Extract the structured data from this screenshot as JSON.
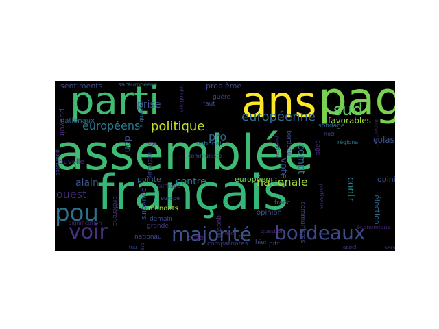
{
  "wordcloud": {
    "background": "#000000",
    "words": [
      {
        "text": "assemblée",
        "color": "#3fbc73"
      },
      {
        "text": "français",
        "color": "#35b779"
      },
      {
        "text": "parti",
        "color": "#3fbc73"
      },
      {
        "text": "ans",
        "color": "#fde725"
      },
      {
        "text": "pag",
        "color": "#7ad151"
      },
      {
        "text": "pou",
        "color": "#2c728e"
      },
      {
        "text": "voir",
        "color": "#46327e"
      },
      {
        "text": "majorité",
        "color": "#3b528b"
      },
      {
        "text": "bordeaux",
        "color": "#3e4989"
      },
      {
        "text": "politique",
        "color": "#c8e020"
      },
      {
        "text": "européenne",
        "color": "#31688e"
      },
      {
        "text": "européens",
        "color": "#2a788e"
      },
      {
        "text": "nationale",
        "color": "#a0da39"
      },
      {
        "text": "sud",
        "color": "#5ec962"
      },
      {
        "text": "alain",
        "color": "#3b528b"
      },
      {
        "text": "ouest",
        "color": "#472d7b"
      },
      {
        "text": "contre",
        "color": "#2a788e"
      },
      {
        "text": "prise",
        "color": "#3b528b"
      },
      {
        "text": "pro",
        "color": "#31688e"
      },
      {
        "text": "vote",
        "color": "#3b528b"
      },
      {
        "text": "compt",
        "color": "#2c728e"
      },
      {
        "text": "contr",
        "color": "#26828e"
      },
      {
        "text": "colas",
        "color": "#3b528b"
      },
      {
        "text": "favorables",
        "color": "#a0da39"
      },
      {
        "text": "européen",
        "color": "#7ad151"
      },
      {
        "text": "sentiments",
        "color": "#3e4989"
      },
      {
        "text": "problème",
        "color": "#3e4989"
      },
      {
        "text": "pouvoir",
        "color": "#482878"
      },
      {
        "text": "nationaux",
        "color": "#31688e"
      },
      {
        "text": "dan",
        "color": "#3b528b"
      },
      {
        "text": "pointe",
        "color": "#31688e"
      },
      {
        "text": "pouvoirs",
        "color": "#3e4989"
      },
      {
        "text": "mandats",
        "color": "#b5de2b"
      },
      {
        "text": "demain",
        "color": "#3e4989"
      },
      {
        "text": "opinio",
        "color": "#3b528b"
      },
      {
        "text": "élection",
        "color": "#31688e"
      },
      {
        "text": "nationau",
        "color": "#3e4989"
      },
      {
        "text": "quatr",
        "color": "#482878"
      },
      {
        "text": "compatriotes",
        "color": "#443983"
      },
      {
        "text": "hier",
        "color": "#3e4989"
      },
      {
        "text": "communiste",
        "color": "#3b528b"
      },
      {
        "text": "nouvelle",
        "color": "#482878"
      },
      {
        "text": "grande",
        "color": "#443983"
      },
      {
        "text": "sondage",
        "color": "#31688e"
      },
      {
        "text": "franc",
        "color": "#3b528b"
      },
      {
        "text": "questio",
        "color": "#472d7b"
      },
      {
        "text": "novembre",
        "color": "#31688e"
      },
      {
        "text": "européenn",
        "color": "#2a788e"
      },
      {
        "text": "guère",
        "color": "#3e4989"
      },
      {
        "text": "faut",
        "color": "#3e4989"
      },
      {
        "text": "national",
        "color": "#2a788e"
      },
      {
        "text": "bordeau",
        "color": "#3e4989"
      },
      {
        "text": "position",
        "color": "#443983"
      },
      {
        "text": "important",
        "color": "#482878"
      },
      {
        "text": "communistes",
        "color": "#3e4989"
      },
      {
        "text": "partisans",
        "color": "#472d7b"
      },
      {
        "text": "économique",
        "color": "#482878"
      },
      {
        "text": "intentions",
        "color": "#482878"
      },
      {
        "text": "gaullistes",
        "color": "#3e4989"
      },
      {
        "text": "intérieure",
        "color": "#3e4989"
      },
      {
        "text": "europe",
        "color": "#3e4989"
      },
      {
        "text": "sam",
        "color": "#3e4989"
      },
      {
        "text": "préférenc",
        "color": "#443983"
      },
      {
        "text": "suffrage",
        "color": "#482878"
      },
      {
        "text": "signification",
        "color": "#482878"
      },
      {
        "text": "notr",
        "color": "#3e4989"
      },
      {
        "text": "page",
        "color": "#472d7b"
      },
      {
        "text": "opinion",
        "color": "#3b528b"
      },
      {
        "text": "question",
        "color": "#482878"
      },
      {
        "text": "pitr",
        "color": "#3e4989"
      },
      {
        "text": "service",
        "color": "#443983"
      },
      {
        "text": "dem",
        "color": "#482878"
      },
      {
        "text": "ren",
        "color": "#3e4989"
      },
      {
        "text": "tou",
        "color": "#3e4989"
      },
      {
        "text": "brun",
        "color": "#472d7b"
      },
      {
        "text": "régional",
        "color": "#2a788e"
      },
      {
        "text": "éga",
        "color": "#472d7b"
      },
      {
        "text": "appel",
        "color": "#443983"
      }
    ]
  }
}
